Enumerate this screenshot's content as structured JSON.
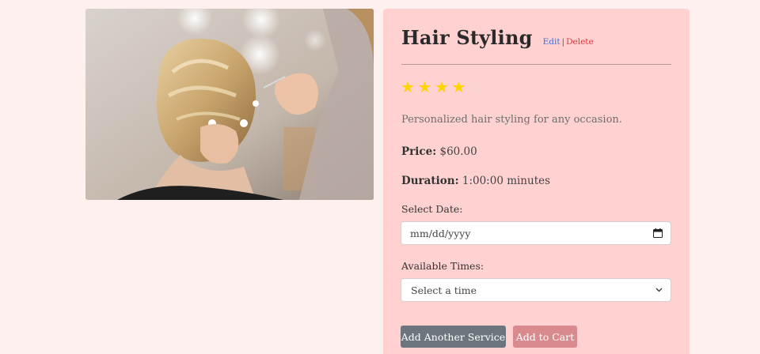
{
  "service": {
    "title": "Hair Styling",
    "rating": 4,
    "rating_max": 5,
    "description": "Personalized hair styling for any occasion.",
    "price_label": "Price:",
    "price_value": "$60.00",
    "duration_label": "Duration:",
    "duration_value": "1:00:00 minutes"
  },
  "admin": {
    "edit_label": "Edit",
    "separator": "|",
    "delete_label": "Delete"
  },
  "booking": {
    "date_label": "Select Date:",
    "date_placeholder": "mm/dd/yyyy",
    "times_label": "Available Times:",
    "times_selected": "Select a time"
  },
  "actions": {
    "add_another_label": "Add Another Service",
    "add_to_cart_label": "Add to Cart"
  },
  "colors": {
    "page_bg": "#fff0f0",
    "card_bg": "#ffd1d1",
    "star_filled": "#ffd400",
    "star_empty": "#e9e0c6",
    "edit_link": "#3b6fd8",
    "delete_link": "#d63b3b",
    "secondary_button": "#6c757d",
    "cart_button": "#d98a8f"
  },
  "icons": {
    "rating": "star-icon",
    "date_picker": "calendar-icon",
    "select": "chevron-down-icon"
  }
}
